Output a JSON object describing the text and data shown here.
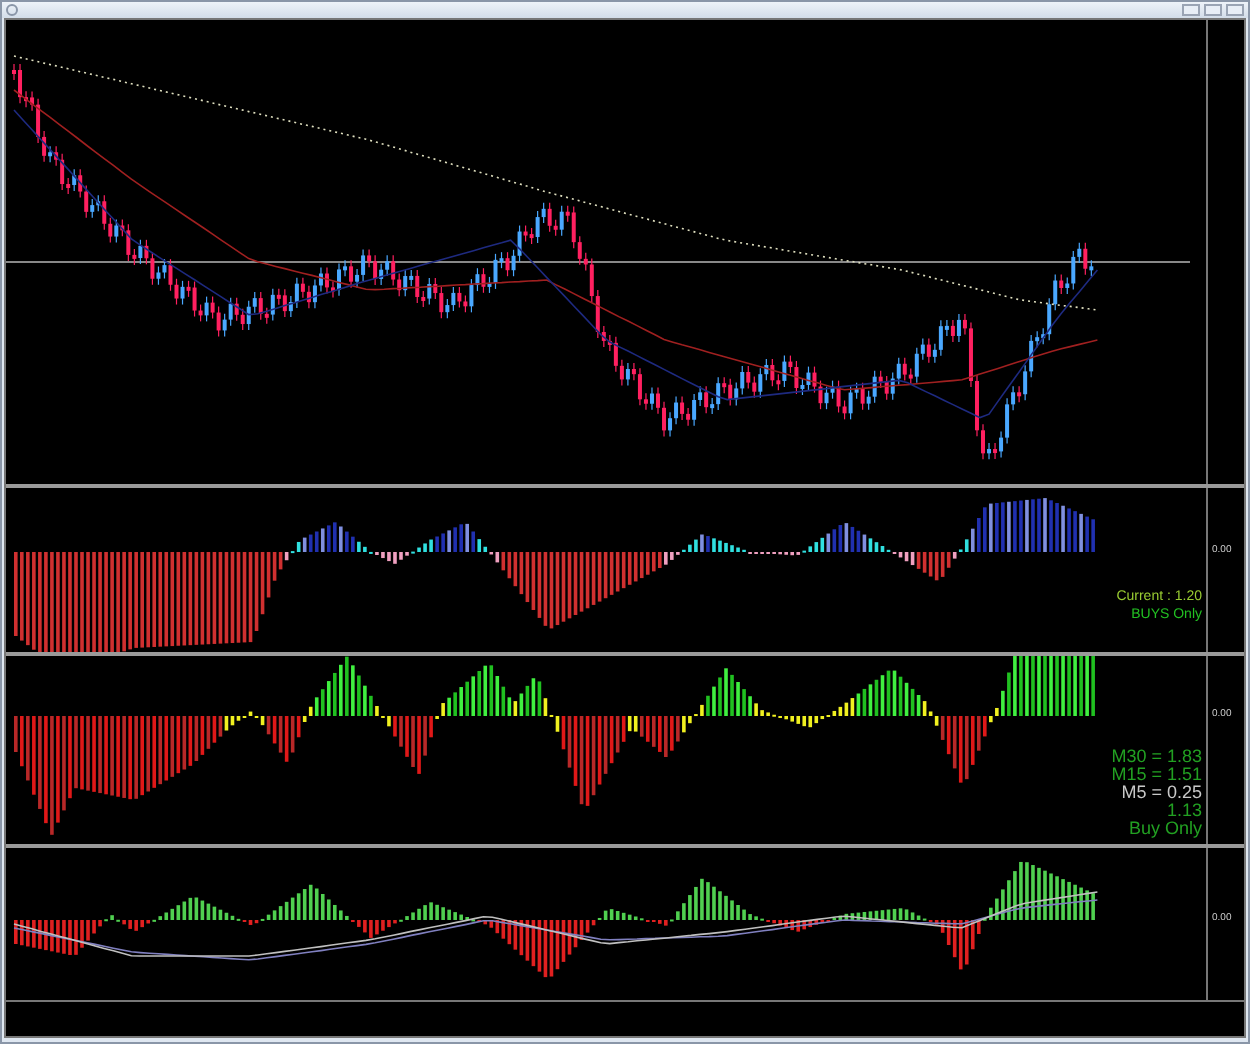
{
  "trend_pane": {
    "zero_label": "0.00",
    "signals": [
      {
        "text": "Current : 1.20",
        "color": "#9acd32"
      },
      {
        "text": "BUYS Only",
        "color": "#22c022"
      }
    ]
  },
  "scalper_pane": {
    "zero_label": "0.00",
    "signals": [
      {
        "text": "M30 = 1.83",
        "color": "#22a022"
      },
      {
        "text": "M15 = 1.51",
        "color": "#22a022"
      },
      {
        "text": "M5 = 0.25",
        "color": "#c8c8c8"
      },
      {
        "text": "1.13",
        "color": "#22a022"
      },
      {
        "text": "Buy Only",
        "color": "#22a022"
      }
    ]
  },
  "macd_pane": {
    "zero_label": "0.00"
  }
}
